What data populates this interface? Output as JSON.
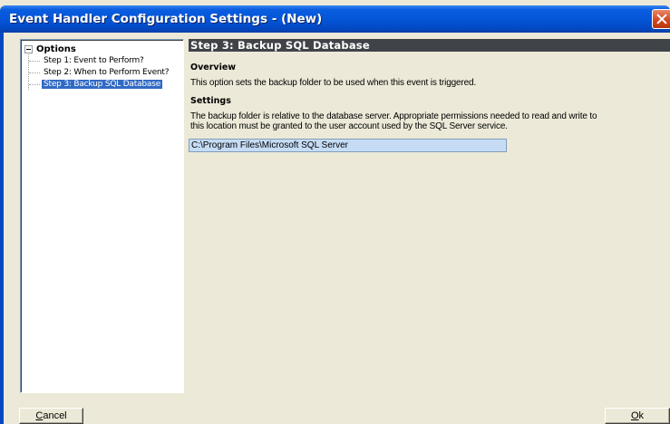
{
  "window": {
    "title": "Event Handler Configuration Settings - (New)"
  },
  "tree": {
    "root_label": "Options",
    "items": [
      {
        "label": "Step 1: Event to Perform?"
      },
      {
        "label": "Step 2: When to Perform Event?"
      },
      {
        "label": "Step 3: Backup SQL Database"
      }
    ],
    "selected_index": 2
  },
  "content": {
    "heading": "Step 3: Backup SQL Database",
    "overview_label": "Overview",
    "overview_text": "This option sets the backup folder to be used when this event is triggered.",
    "settings_label": "Settings",
    "settings_text_line1": "The backup folder is relative to the database server. Appropriate permissions needed to read and write to",
    "settings_text_line2": "this location must be granted to the user account used by the SQL Server service.",
    "backup_path": "C:\\Program Files\\Microsoft SQL Server"
  },
  "buttons": {
    "cancel_mnemonic": "C",
    "cancel_rest": "ancel",
    "ok_mnemonic": "O",
    "ok_rest": "k"
  },
  "colors": {
    "titlebar": "#0454d6",
    "dialog_bg": "#ece9d8",
    "heading_bg": "#404448",
    "selection": "#316ac5",
    "input_bg": "#c6dcf5",
    "close_button": "#d0441c"
  }
}
